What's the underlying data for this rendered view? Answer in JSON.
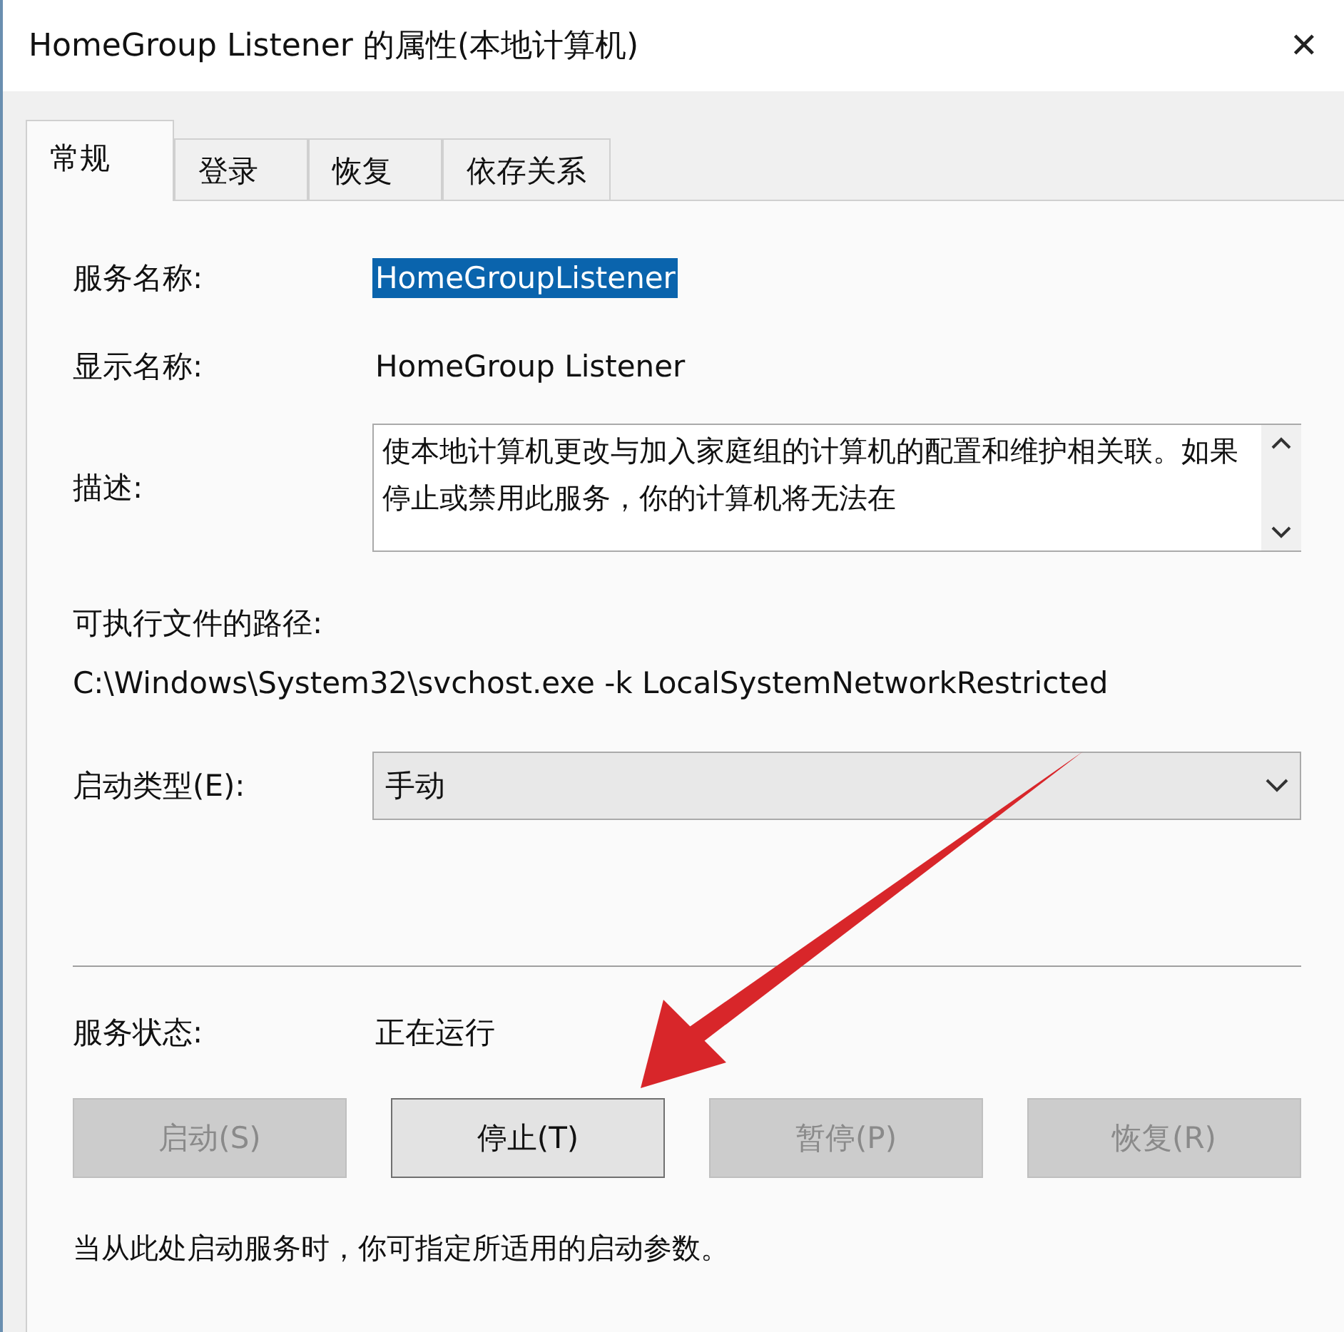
{
  "window": {
    "title": "HomeGroup Listener 的属性(本地计算机)",
    "close": "✕"
  },
  "tabs": [
    {
      "label": "常规",
      "selected": true
    },
    {
      "label": "登录",
      "selected": false
    },
    {
      "label": "恢复",
      "selected": false
    },
    {
      "label": "依存关系",
      "selected": false
    }
  ],
  "service_name": {
    "label": "服务名称:",
    "value": "HomeGroupListener",
    "selected": true
  },
  "display_name": {
    "label": "显示名称:",
    "value": "HomeGroup Listener"
  },
  "description": {
    "label": "描述:",
    "value": "使本地计算机更改与加入家庭组的计算机的配置和维护相关联。如果停止或禁用此服务，你的计算机将无法在"
  },
  "path": {
    "label": "可执行文件的路径:",
    "value": "C:\\Windows\\System32\\svchost.exe -k LocalSystemNetworkRestricted"
  },
  "startup_type": {
    "label": "启动类型(E):",
    "value": "手动"
  },
  "status": {
    "label": "服务状态:",
    "value": "正在运行"
  },
  "buttons": [
    {
      "label": "启动(S)",
      "disabled": true
    },
    {
      "label": "停止(T)",
      "disabled": false
    },
    {
      "label": "暂停(P)",
      "disabled": true
    },
    {
      "label": "恢复(R)",
      "disabled": true
    }
  ],
  "note": "当从此处启动服务时，你可指定所适用的启动参数。"
}
